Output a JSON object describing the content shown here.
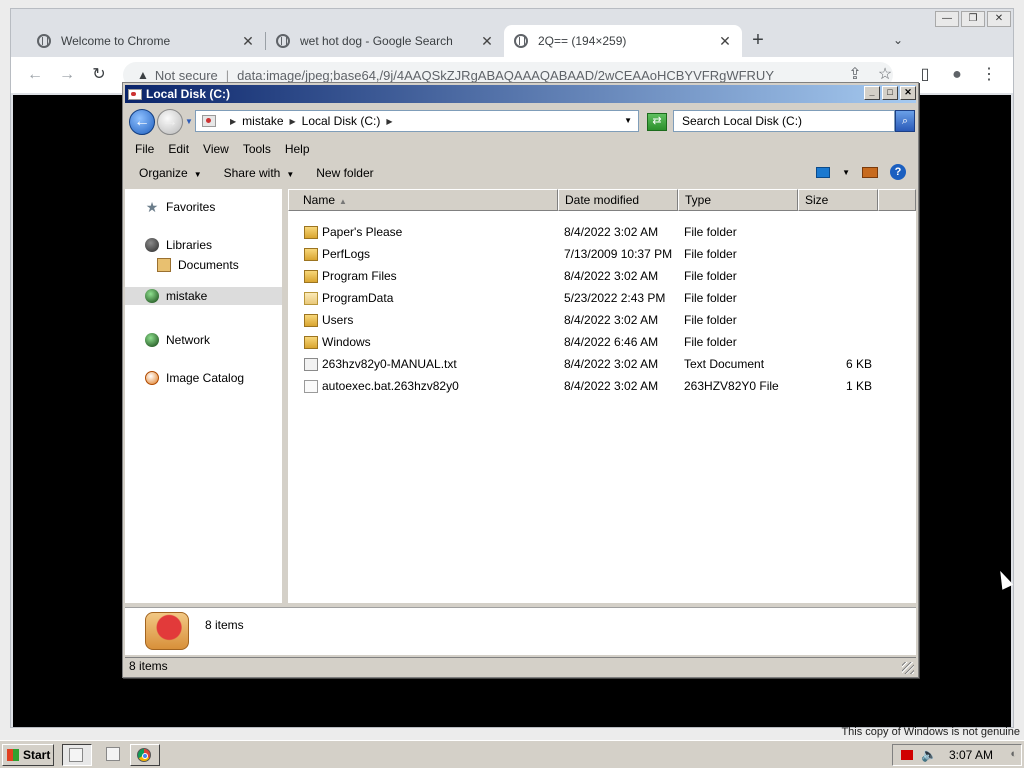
{
  "browser": {
    "tabs": [
      {
        "title": "Welcome to Chrome",
        "active": false
      },
      {
        "title": "wet hot dog - Google Search",
        "active": false
      },
      {
        "title": "2Q== (194×259)",
        "active": true
      }
    ],
    "new_tab": "+",
    "url_warning": "Not secure",
    "url": "data:image/jpeg;base64,/9j/4AAQSkZJRgABAQAAAQABAAD/2wCEAAoHCBYVFRgWFRUY"
  },
  "explorer": {
    "title": "Local Disk (C:)",
    "breadcrumb": [
      "mistake",
      "Local Disk (C:)"
    ],
    "search_placeholder": "Search Local Disk (C:)",
    "menu": [
      "File",
      "Edit",
      "View",
      "Tools",
      "Help"
    ],
    "commands": {
      "organize": "Organize",
      "share_with": "Share with",
      "new_folder": "New folder"
    },
    "nav": {
      "favorites": "Favorites",
      "libraries": "Libraries",
      "documents": "Documents",
      "mistake": "mistake",
      "network": "Network",
      "image_catalog": "Image Catalog"
    },
    "columns": {
      "name": "Name",
      "date": "Date modified",
      "type": "Type",
      "size": "Size"
    },
    "files": [
      {
        "name": "Paper's Please",
        "date": "8/4/2022 3:02 AM",
        "type": "File folder",
        "size": "",
        "icon": "folder-icon"
      },
      {
        "name": "PerfLogs",
        "date": "7/13/2009 10:37 PM",
        "type": "File folder",
        "size": "",
        "icon": "folder-icon"
      },
      {
        "name": "Program Files",
        "date": "8/4/2022 3:02 AM",
        "type": "File folder",
        "size": "",
        "icon": "folder-icon"
      },
      {
        "name": "ProgramData",
        "date": "5/23/2022 2:43 PM",
        "type": "File folder",
        "size": "",
        "icon": "folder-icon"
      },
      {
        "name": "Users",
        "date": "8/4/2022 3:02 AM",
        "type": "File folder",
        "size": "",
        "icon": "folder-icon"
      },
      {
        "name": "Windows",
        "date": "8/4/2022 6:46 AM",
        "type": "File folder",
        "size": "",
        "icon": "folder-icon"
      },
      {
        "name": "263hzv82y0-MANUAL.txt",
        "date": "8/4/2022 3:02 AM",
        "type": "Text Document",
        "size": "6 KB",
        "icon": "text-file-icon"
      },
      {
        "name": "autoexec.bat.263hzv82y0",
        "date": "8/4/2022 3:02 AM",
        "type": "263HZV82Y0 File",
        "size": "1 KB",
        "icon": "file-icon"
      }
    ],
    "details_count": "8 items",
    "status": "8 items"
  },
  "desktop": {
    "genuine_notice": "This copy of Windows is not genuine"
  },
  "taskbar": {
    "start": "Start",
    "clock": "3:07 AM"
  }
}
